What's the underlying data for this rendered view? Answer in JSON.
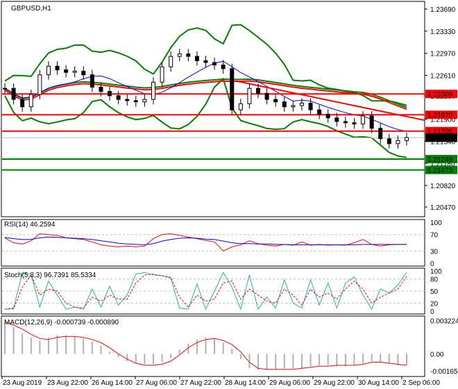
{
  "chart_data": {
    "type": "line",
    "symbol_title": "GBPUSD,H1",
    "price_axis": {
      "min": 1.2047,
      "max": 1.2369,
      "ticks": [
        "1.23690",
        "1.23330",
        "1.22970",
        "1.22610",
        "1.22280",
        "1.21900",
        "1.21540",
        "1.21180",
        "1.20820",
        "1.20470"
      ]
    },
    "levels": [
      {
        "label": "1.22309",
        "value": 1.22309,
        "color": "#ff0000"
      },
      {
        "label": "1.21970",
        "value": 1.2197,
        "color": "#ff0000"
      },
      {
        "label": "1.21705",
        "value": 1.21705,
        "color": "#ff0000"
      },
      {
        "label": "1.21249",
        "value": 1.21249,
        "color": "#008000"
      },
      {
        "label": "1.21073",
        "value": 1.21073,
        "color": "#008000"
      }
    ],
    "current_price": {
      "label": "1.21596",
      "value": 1.21596
    },
    "trendline": {
      "from": 1.2252,
      "to": 1.2188,
      "color": "#ff0000"
    },
    "closes": [
      1.224,
      1.2222,
      1.221,
      1.223,
      1.2262,
      1.2276,
      1.227,
      1.2266,
      1.2268,
      1.2262,
      1.2242,
      1.2235,
      1.2228,
      1.2222,
      1.222,
      1.2218,
      1.2222,
      1.225,
      1.2275,
      1.2292,
      1.2296,
      1.2292,
      1.2285,
      1.2282,
      1.2278,
      1.2272,
      1.2205,
      1.2215,
      1.224,
      1.2232,
      1.2222,
      1.2218,
      1.221,
      1.2212,
      1.2216,
      1.2205,
      1.2198,
      1.2192,
      1.2186,
      1.2184,
      1.2182,
      1.2195,
      1.2175,
      1.2158,
      1.215,
      1.2155,
      1.216
    ],
    "x_labels": [
      "23 Aug 2019",
      "23 Aug 22:00",
      "26 Aug 14:00",
      "27 Aug 06:00",
      "27 Aug 22:00",
      "28 Aug 14:00",
      "29 Aug 06:00",
      "29 Aug 22:00",
      "30 Aug 14:00",
      "2 Sep 06:00"
    ],
    "rsi": {
      "label": "RSI(14) 46.2594",
      "ticks": [
        "100",
        "70",
        "30",
        "0"
      ],
      "levels": [
        70,
        30
      ],
      "values": [
        62,
        50,
        47,
        55,
        72,
        70,
        68,
        62,
        60,
        58,
        52,
        45,
        42,
        40,
        42,
        40,
        42,
        60,
        70,
        72,
        68,
        64,
        60,
        56,
        52,
        30,
        40,
        45,
        55,
        48,
        44,
        42,
        46,
        44,
        52,
        44,
        46,
        44,
        45,
        44,
        50,
        58,
        46,
        42,
        45,
        46,
        46
      ],
      "signal": [
        63,
        60,
        58,
        58,
        62,
        64,
        63,
        62,
        61,
        60,
        58,
        55,
        52,
        49,
        47,
        46,
        45,
        48,
        54,
        58,
        61,
        62,
        61,
        59,
        58,
        54,
        50,
        48,
        48,
        47,
        47,
        46,
        46,
        45,
        45,
        45,
        45,
        45,
        45,
        45,
        45,
        46,
        46,
        46,
        46,
        46,
        46
      ]
    },
    "stoch": {
      "label": "Stoch(5,3,3) 96.7391 85.5334",
      "ticks": [
        "100",
        "80",
        "50",
        "20",
        "0"
      ],
      "levels": [
        80,
        50,
        20
      ],
      "main": [
        5,
        8,
        95,
        92,
        10,
        75,
        40,
        5,
        10,
        5,
        55,
        10,
        62,
        15,
        40,
        92,
        96,
        90,
        88,
        82,
        8,
        5,
        68,
        5,
        50,
        96,
        60,
        5,
        90,
        5,
        35,
        8,
        78,
        20,
        8,
        78,
        15,
        70,
        8,
        70,
        85,
        40,
        5,
        55,
        45,
        65,
        97
      ],
      "signal": [
        5,
        6,
        60,
        90,
        40,
        55,
        50,
        20,
        10,
        8,
        35,
        25,
        40,
        30,
        30,
        70,
        90,
        92,
        88,
        84,
        35,
        10,
        40,
        25,
        30,
        70,
        75,
        30,
        55,
        40,
        25,
        20,
        55,
        40,
        15,
        55,
        35,
        45,
        30,
        55,
        75,
        55,
        20,
        35,
        45,
        55,
        86
      ]
    },
    "macd": {
      "label": "MACD(12,26,9) -0.000739 -0.000890",
      "ticks": [
        "0.003224",
        "0.00",
        "-0.001653"
      ],
      "min": -0.00185,
      "max": 0.0034,
      "main": [
        0.003,
        0.0026,
        0.002,
        0.0016,
        0.0013,
        0.0016,
        0.0018,
        0.0018,
        0.0017,
        0.0015,
        0.0012,
        0.0008,
        0.0002,
        -0.0003,
        -0.0007,
        -0.0009,
        -0.001,
        -0.001,
        -0.0008,
        -0.0004,
        0.0004,
        0.001,
        0.0014,
        0.0016,
        0.0015,
        0.0011,
        0.0005,
        -0.0005,
        -0.0014,
        -0.0015,
        -0.0015,
        -0.0015,
        -0.0014,
        -0.0014,
        -0.0014,
        -0.0012,
        -0.0011,
        -0.0011,
        -0.0012,
        -0.0012,
        -0.0011,
        -0.0009,
        -0.0007,
        -0.0008,
        -0.0009,
        -0.0011,
        -0.0011
      ],
      "signal": [
        0.0031,
        0.0028,
        0.0024,
        0.0019,
        0.0015,
        0.0014,
        0.0016,
        0.0017,
        0.0017,
        0.0016,
        0.0014,
        0.0011,
        0.0006,
        0.0,
        -0.0005,
        -0.0009,
        -0.0011,
        -0.0011,
        -0.001,
        -0.0007,
        -0.0001,
        0.0006,
        0.0011,
        0.0014,
        0.0015,
        0.0013,
        0.0009,
        0.0002,
        -0.0008,
        -0.0014,
        -0.0015,
        -0.0015,
        -0.0015,
        -0.0015,
        -0.0014,
        -0.0013,
        -0.0012,
        -0.0012,
        -0.0011,
        -0.0011,
        -0.0011,
        -0.001,
        -0.0008,
        -0.0008,
        -0.0009,
        -0.001,
        -0.0011
      ]
    }
  }
}
